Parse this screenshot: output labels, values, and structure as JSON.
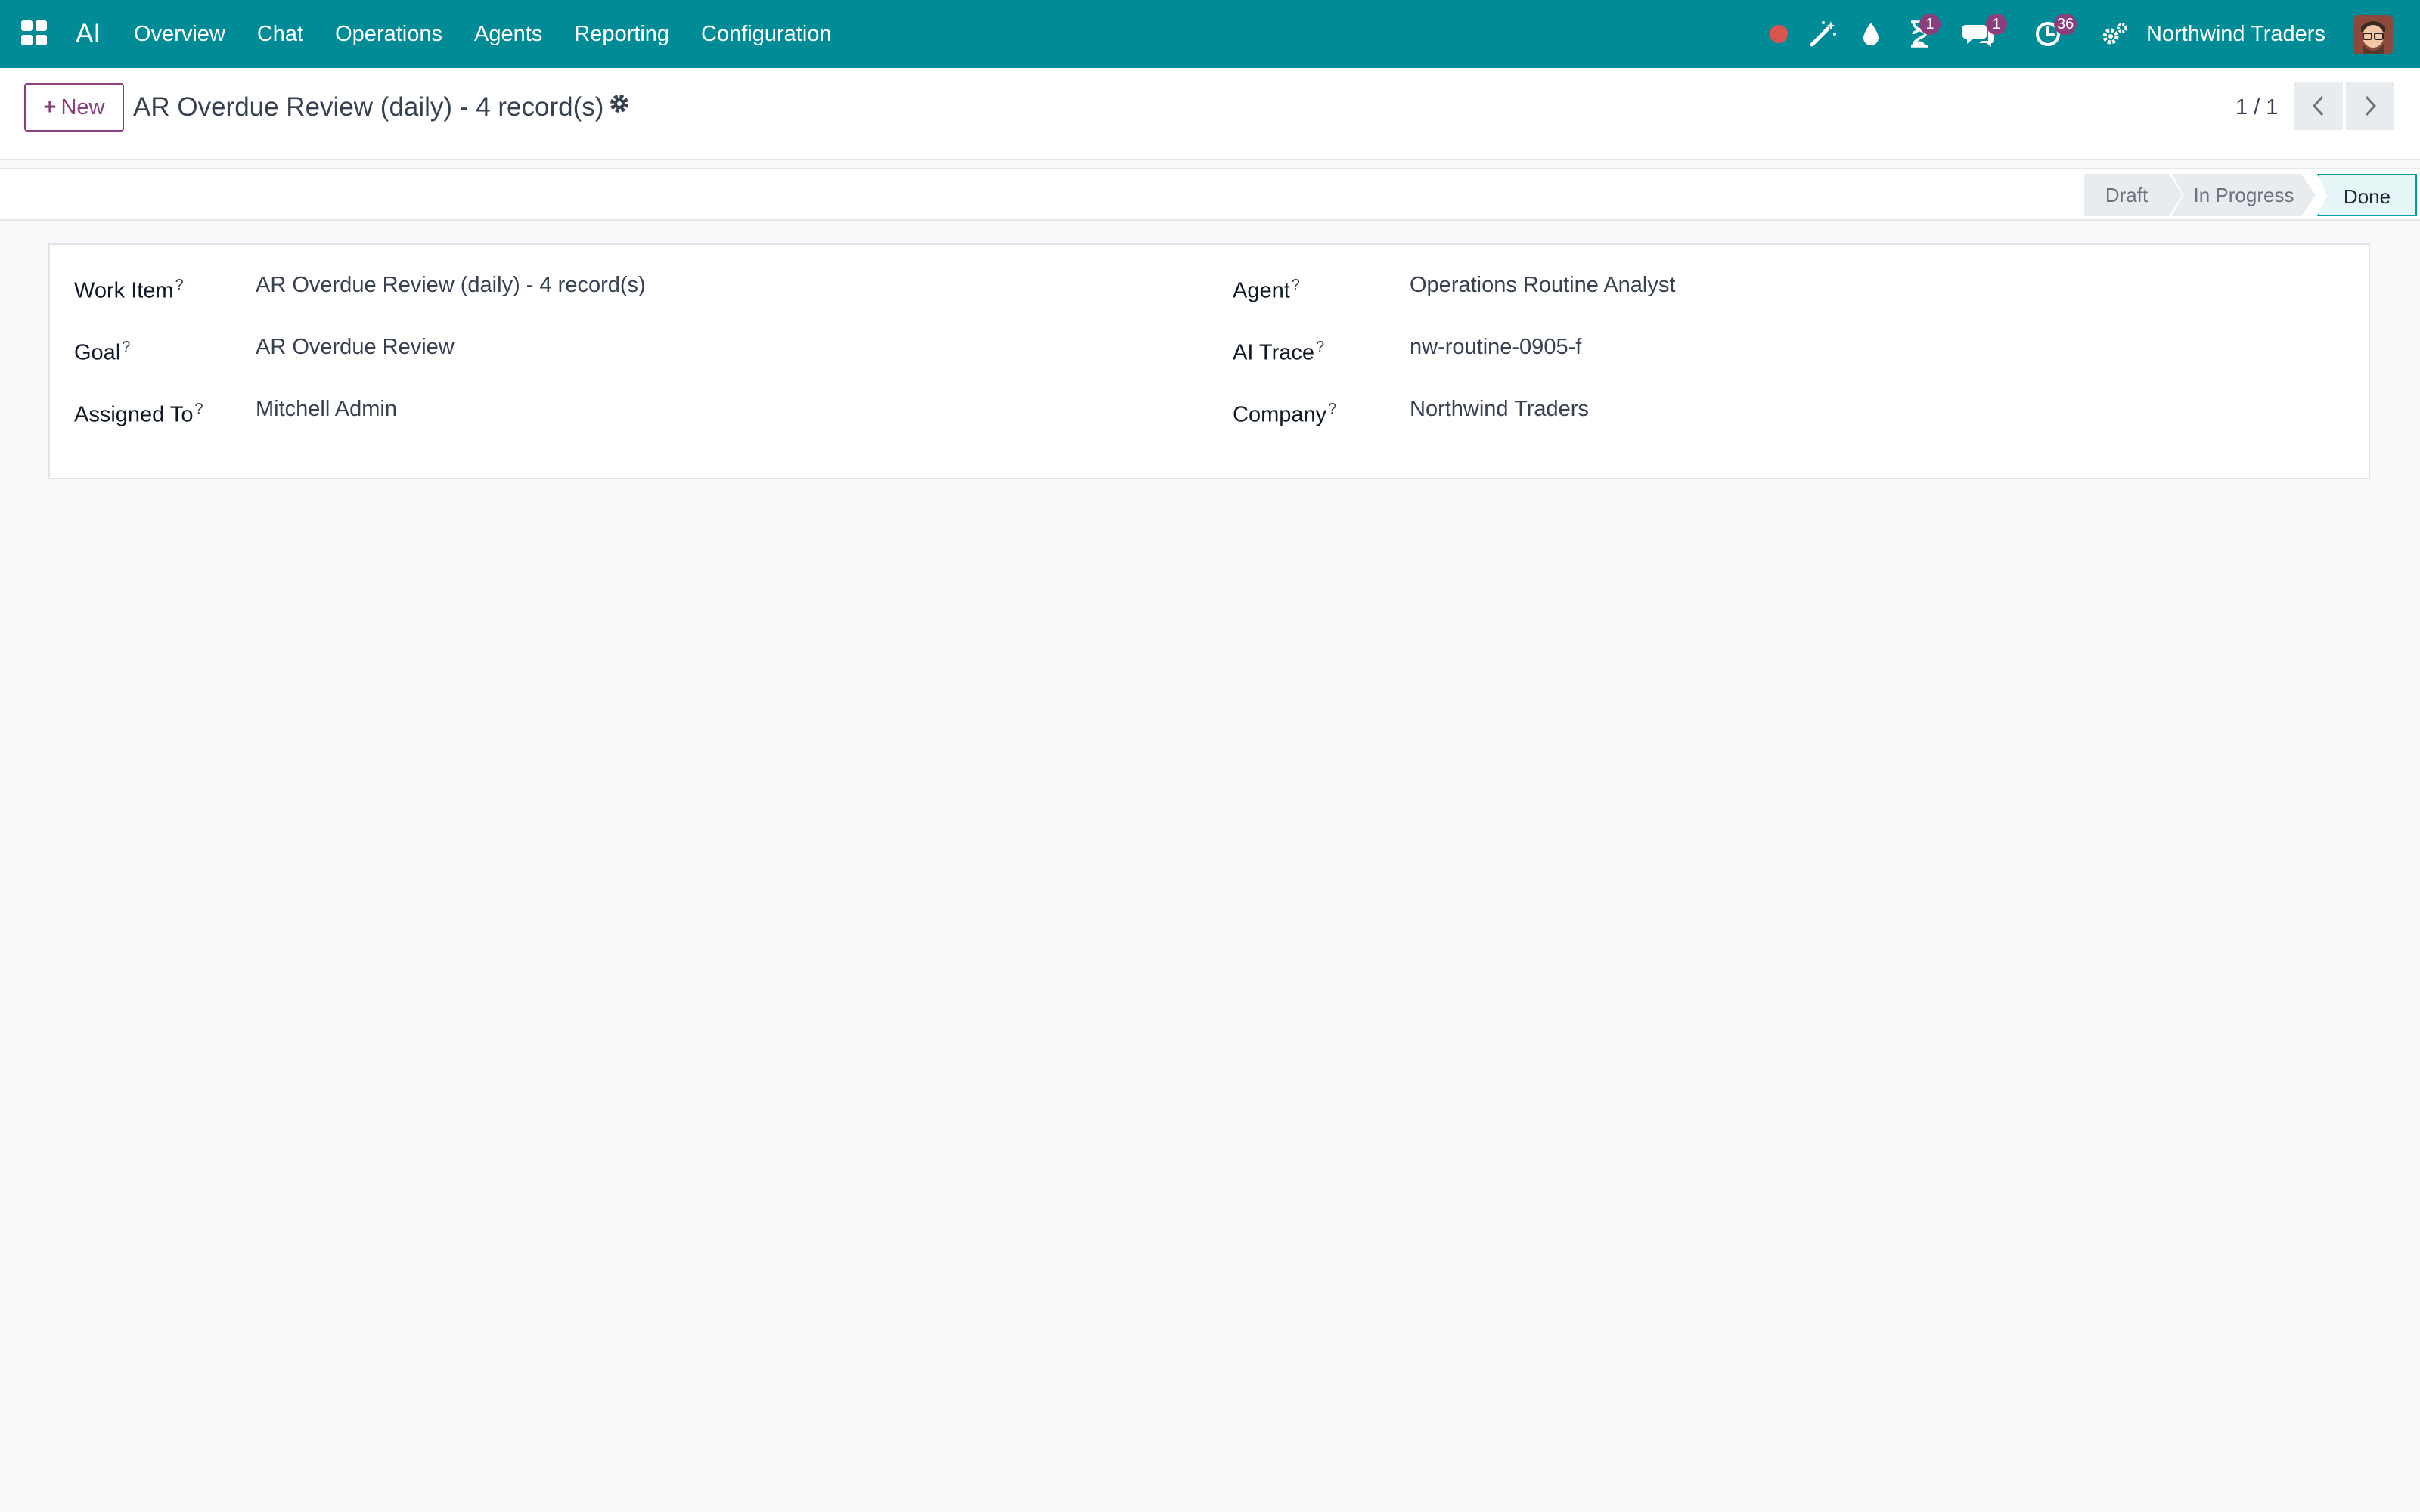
{
  "navbar": {
    "brand": "AI",
    "menu": [
      "Overview",
      "Chat",
      "Operations",
      "Agents",
      "Reporting",
      "Configuration"
    ],
    "badges": {
      "activities": "1",
      "messages": "1",
      "clock": "36"
    },
    "company": "Northwind Traders",
    "colors": {
      "bar": "#008b96",
      "badge": "#8a3f7c",
      "recording_dot": "#d9534f"
    }
  },
  "control": {
    "new_label": "New",
    "title": "AR Overdue Review (daily) - 4 record(s)",
    "pager": "1 / 1"
  },
  "status": {
    "stages": [
      "Draft",
      "In Progress",
      "Done"
    ],
    "current": "Done"
  },
  "form": {
    "tooltip_mark": "?",
    "left": [
      {
        "label": "Work Item",
        "value": "AR Overdue Review (daily) - 4 record(s)"
      },
      {
        "label": "Goal",
        "value": "AR Overdue Review"
      },
      {
        "label": "Assigned To",
        "value": "Mitchell Admin"
      }
    ],
    "right": [
      {
        "label": "Agent",
        "value": "Operations Routine Analyst"
      },
      {
        "label": "AI Trace",
        "value": "nw-routine-0905-f"
      },
      {
        "label": "Company",
        "value": "Northwind Traders"
      }
    ]
  }
}
